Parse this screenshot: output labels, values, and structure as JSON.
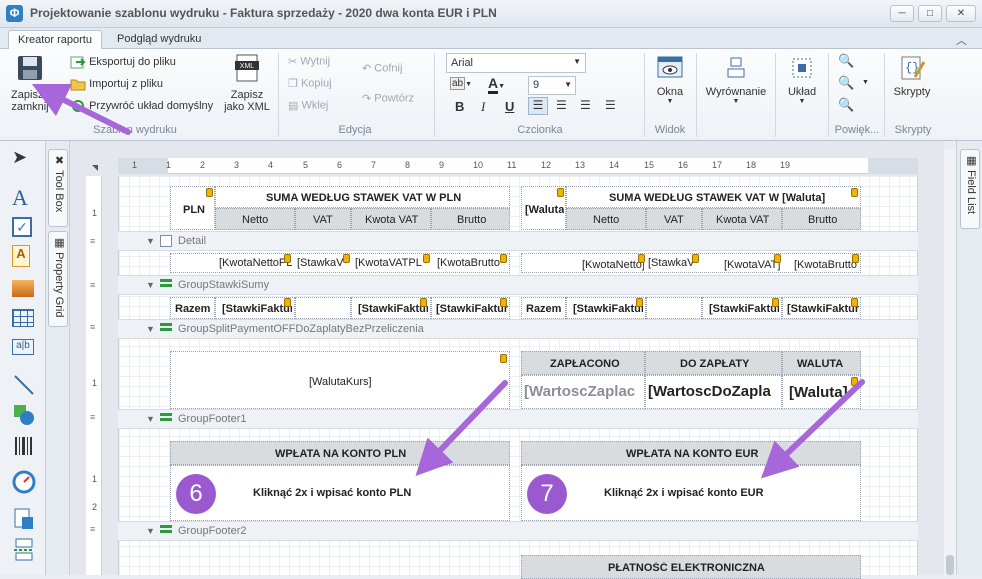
{
  "window": {
    "title": "Projektowanie szablonu wydruku - Faktura sprzedaży - 2020 dwa konta EUR i PLN",
    "app_icon": "app-logo-icon"
  },
  "tabs": [
    {
      "label": "Kreator raportu",
      "active": true
    },
    {
      "label": "Podgląd wydruku",
      "active": false
    }
  ],
  "ribbon": {
    "szablon": {
      "group_label": "Szablon wydruku",
      "save_close": "Zapisz i\nzamknij",
      "export": "Eksportuj do pliku",
      "import": "Importuj z pliku",
      "restore": "Przywróć układ domyślny",
      "save_xml": "Zapisz\njako XML"
    },
    "edycja": {
      "group_label": "Edycja",
      "cut": "Wytnij",
      "copy": "Kopiuj",
      "paste": "Wklej",
      "undo": "Cofnij",
      "redo": "Powtórz"
    },
    "czcionka": {
      "group_label": "Czcionka",
      "font_name": "Arial",
      "font_size": "9",
      "bold": "B",
      "italic": "I",
      "underline": "U"
    },
    "widok": {
      "group_label": "Widok",
      "okna": "Okna"
    },
    "wyrownanie": {
      "label": "Wyrównanie"
    },
    "uklad": {
      "label": "Układ"
    },
    "powiekszenie": {
      "group_label": "Powięk..."
    },
    "skrypty": {
      "group_label": "Skrypty",
      "label": "Skrypty"
    }
  },
  "side_tabs": {
    "toolbox": "Tool Box",
    "property_grid": "Property Grid",
    "field_list": "Field List"
  },
  "ruler": {
    "ticks": [
      "1",
      "1",
      "2",
      "3",
      "4",
      "5",
      "6",
      "7",
      "8",
      "9",
      "10",
      "11",
      "12",
      "13",
      "14",
      "15",
      "16",
      "17",
      "18",
      "19"
    ]
  },
  "bands": {
    "detail": "Detail",
    "group_stawki": "GroupStawkiSumy",
    "group_split": "GroupSplitPaymentOFFDoZaplatyBezPrzeliczenia",
    "footer1": "GroupFooter1",
    "footer2": "GroupFooter2"
  },
  "report": {
    "pln_label": "PLN",
    "waluta_label": "[Waluta",
    "vat_header_pln": "SUMA WEDŁUG STAWEK VAT W PLN",
    "vat_header_waluta": "SUMA WEDŁUG STAWEK VAT W [Waluta]",
    "col_netto": "Netto",
    "col_vat": "VAT",
    "col_kwota_vat": "Kwota VAT",
    "col_brutto": "Brutto",
    "detail_left": [
      "[KwotaNettoPL",
      "[StawkaV",
      "[KwotaVATPL",
      "[KwotaBrutto"
    ],
    "detail_right": [
      "[KwotaNetto]",
      "[StawkaV",
      "[KwotaVAT]",
      "[KwotaBrutto"
    ],
    "razem": "Razem",
    "sum_left": [
      "[StawkiFaktur",
      "[StawkiFaktur",
      "[StawkiFaktur"
    ],
    "sum_right": [
      "[StawkiFaktur",
      "[StawkiFaktur",
      "[StawkiFaktur"
    ],
    "waluta_kurs": "[WalutaKurs]",
    "zaplacono": "ZAPŁACONO",
    "do_zaplaty": "DO ZAPŁATY",
    "waluta_col": "WALUTA",
    "val_zaplac": "[WartoscZaplac",
    "val_do_zapla": "[WartoscDoZapla",
    "val_waluta": "[Waluta]",
    "wplata_pln": "WPŁATA NA KONTO PLN",
    "wplata_eur": "WPŁATA NA KONTO EUR",
    "instr_pln": "Kliknąć 2x i wpisać konto PLN",
    "instr_eur": "Kliknąć 2x i wpisać konto EUR",
    "platnosc": "PŁATNOŚĆ ELEKTRONICZNA"
  },
  "annotations": {
    "badge_6": "6",
    "badge_7": "7",
    "arrow_color": "#a766d9"
  },
  "colors": {
    "header_gray": "#d9dcdf",
    "accent_blue": "#2f7fc7",
    "badge": "#9b59d0"
  }
}
